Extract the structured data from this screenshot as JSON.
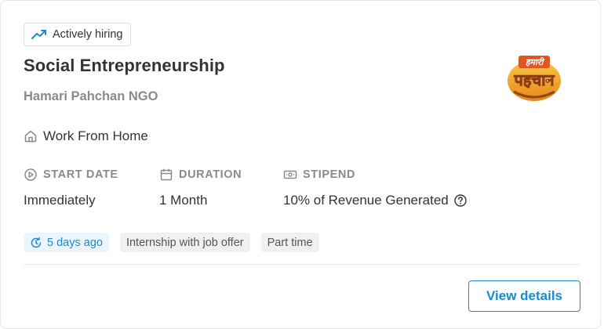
{
  "card": {
    "badge": {
      "label": "Actively hiring",
      "icon": "trending-up-icon"
    },
    "title": "Social Entrepreneurship",
    "company": "Hamari Pahchan NGO",
    "logo": {
      "icon": "company-logo",
      "text_top": "हमारी",
      "text_main": "पहचान"
    },
    "location": {
      "label": "Work From Home",
      "icon": "home-icon"
    },
    "meta": [
      {
        "heading": "START DATE",
        "value": "Immediately",
        "icon": "play-circle-icon"
      },
      {
        "heading": "DURATION",
        "value": "1 Month",
        "icon": "calendar-icon"
      },
      {
        "heading": "STIPEND",
        "value": "10% of Revenue Generated",
        "icon": "money-icon"
      }
    ],
    "tags": {
      "posted": "5 days ago",
      "job_offer": "Internship with job offer",
      "part_time": "Part time"
    },
    "view_details": "View details"
  },
  "colors": {
    "accent": "#1a8bc6",
    "text": "#333333",
    "muted": "#8a8a8a",
    "tag_bg": "#f0f0f0",
    "posted_bg": "#eaf6fc"
  }
}
